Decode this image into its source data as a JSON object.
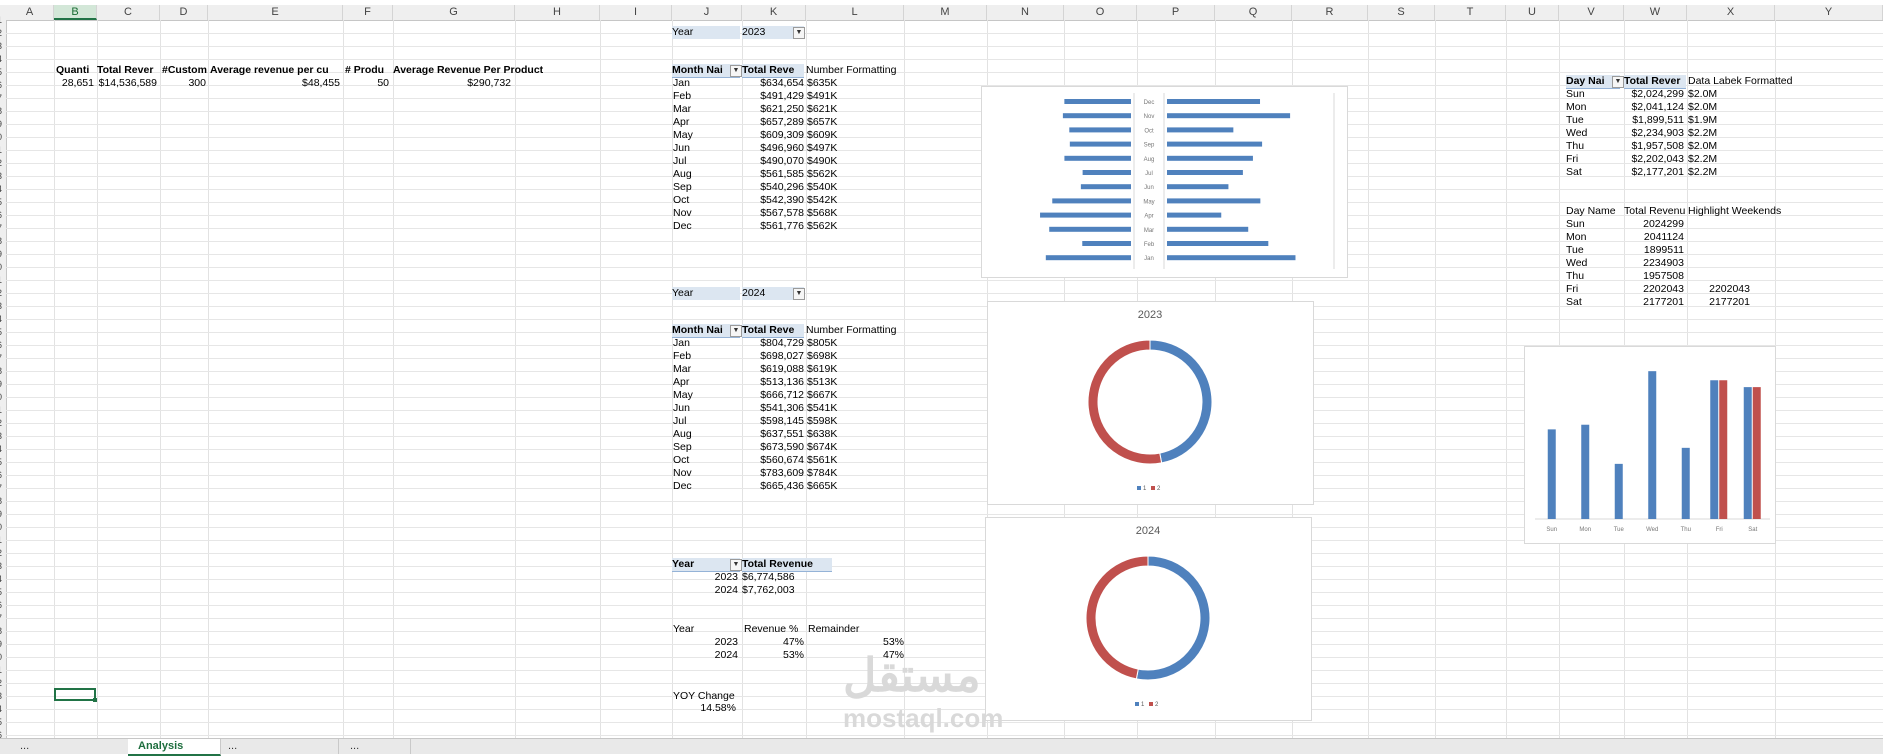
{
  "columns": [
    "A",
    "B",
    "C",
    "D",
    "E",
    "F",
    "G",
    "H",
    "I",
    "J",
    "K",
    "L",
    "M",
    "N",
    "O",
    "P",
    "Q",
    "R",
    "S",
    "T",
    "U",
    "V",
    "W",
    "X",
    "Y"
  ],
  "row_numbers": [
    "1",
    "2",
    "3",
    "4",
    "5",
    "6",
    "7",
    "8",
    "9",
    "0",
    "1",
    "2",
    "3",
    "4",
    "5",
    "6",
    "7",
    "8",
    "9",
    "0",
    "1",
    "2",
    "3",
    "4",
    "5",
    "6",
    "7",
    "8",
    "9",
    "0",
    "1",
    "2",
    "3",
    "4",
    "5",
    "6",
    "7",
    "8",
    "9",
    "0",
    "1",
    "2",
    "3",
    "4",
    "5",
    "6",
    "7",
    "8",
    "9",
    "0",
    "1",
    "2",
    "3",
    "4",
    "5",
    "6"
  ],
  "kpi": {
    "headers": [
      "Quanti",
      "Total Rever",
      "#Custom",
      "Average revenue per cu",
      "# Produ",
      "Average Revenue Per Product"
    ],
    "values": [
      "28,651",
      "$14,536,589",
      "300",
      "$48,455",
      "50",
      "$290,732"
    ]
  },
  "pivot2023": {
    "filter_label": "Year",
    "filter_value": "2023",
    "col1": "Month Nai",
    "col2": "Total Reve",
    "col3": "Number Formatting",
    "rows": [
      [
        "Jan",
        "$634,654",
        "$635K"
      ],
      [
        "Feb",
        "$491,429",
        "$491K"
      ],
      [
        "Mar",
        "$621,250",
        "$621K"
      ],
      [
        "Apr",
        "$657,289",
        "$657K"
      ],
      [
        "May",
        "$609,309",
        "$609K"
      ],
      [
        "Jun",
        "$496,960",
        "$497K"
      ],
      [
        "Jul",
        "$490,070",
        "$490K"
      ],
      [
        "Aug",
        "$561,585",
        "$562K"
      ],
      [
        "Sep",
        "$540,296",
        "$540K"
      ],
      [
        "Oct",
        "$542,390",
        "$542K"
      ],
      [
        "Nov",
        "$567,578",
        "$568K"
      ],
      [
        "Dec",
        "$561,776",
        "$562K"
      ]
    ]
  },
  "pivot2024": {
    "filter_label": "Year",
    "filter_value": "2024",
    "col1": "Month Nai",
    "col2": "Total Reve",
    "col3": "Number Formatting",
    "rows": [
      [
        "Jan",
        "$804,729",
        "$805K"
      ],
      [
        "Feb",
        "$698,027",
        "$698K"
      ],
      [
        "Mar",
        "$619,088",
        "$619K"
      ],
      [
        "Apr",
        "$513,136",
        "$513K"
      ],
      [
        "May",
        "$666,712",
        "$667K"
      ],
      [
        "Jun",
        "$541,306",
        "$541K"
      ],
      [
        "Jul",
        "$598,145",
        "$598K"
      ],
      [
        "Aug",
        "$637,551",
        "$638K"
      ],
      [
        "Sep",
        "$673,590",
        "$674K"
      ],
      [
        "Oct",
        "$560,674",
        "$561K"
      ],
      [
        "Nov",
        "$783,609",
        "$784K"
      ],
      [
        "Dec",
        "$665,436",
        "$665K"
      ]
    ]
  },
  "year_totals": {
    "col1": "Year",
    "col2": "Total Revenue",
    "rows": [
      [
        "2023",
        "$6,774,586"
      ],
      [
        "2024",
        "$7,762,003"
      ]
    ]
  },
  "revenue_pct": {
    "col1": "Year",
    "col2": "Revenue %",
    "col3": "Remainder",
    "rows": [
      [
        "2023",
        "47%",
        "53%"
      ],
      [
        "2024",
        "53%",
        "47%"
      ]
    ]
  },
  "yoy": {
    "label": "YOY Change",
    "value": "14.58%"
  },
  "day_pivot": {
    "col1": "Day Nai",
    "col2": "Total Rever",
    "col3": "Data Labek Formatted",
    "rows": [
      [
        "Sun",
        "$2,024,299",
        "$2.0M"
      ],
      [
        "Mon",
        "$2,041,124",
        "$2.0M"
      ],
      [
        "Tue",
        "$1,899,511",
        "$1.9M"
      ],
      [
        "Wed",
        "$2,234,903",
        "$2.2M"
      ],
      [
        "Thu",
        "$1,957,508",
        "$2.0M"
      ],
      [
        "Fri",
        "$2,202,043",
        "$2.2M"
      ],
      [
        "Sat",
        "$2,177,201",
        "$2.2M"
      ]
    ]
  },
  "day_table": {
    "col1": "Day Name",
    "col2": "Total Revenu",
    "col3": "Highlight Weekends",
    "rows": [
      [
        "Sun",
        "2024299",
        ""
      ],
      [
        "Mon",
        "2041124",
        ""
      ],
      [
        "Tue",
        "1899511",
        ""
      ],
      [
        "Wed",
        "2234903",
        ""
      ],
      [
        "Thu",
        "1957508",
        ""
      ],
      [
        "Fri",
        "2202043",
        "2202043"
      ],
      [
        "Sat",
        "2177201",
        "2177201"
      ]
    ]
  },
  "chart_data": [
    {
      "type": "bar",
      "orientation": "horizontal-butterfly",
      "title": "",
      "categories": [
        "Dec",
        "Nov",
        "Oct",
        "Sep",
        "Aug",
        "Jul",
        "Jun",
        "May",
        "Apr",
        "Mar",
        "Feb",
        "Jan"
      ],
      "series": [
        {
          "values": [
            561776,
            567578,
            542390,
            540296,
            561585,
            490070,
            496960,
            609309,
            657289,
            621250,
            491429,
            634654
          ]
        },
        {
          "values": [
            665436,
            783609,
            560674,
            673590,
            637551,
            598145,
            541306,
            666712,
            513136,
            619088,
            698027,
            804729
          ]
        }
      ],
      "colors": [
        "#4f81bd",
        "#4f81bd"
      ],
      "xlim": [
        0,
        850000
      ]
    },
    {
      "type": "pie",
      "variant": "doughnut",
      "title": "2023",
      "categories": [
        "1",
        "2"
      ],
      "values": [
        47,
        53
      ],
      "colors": [
        "#4f81bd",
        "#c0504d"
      ],
      "legend": "bottom"
    },
    {
      "type": "pie",
      "variant": "doughnut",
      "title": "2024",
      "categories": [
        "1",
        "2"
      ],
      "values": [
        53,
        47
      ],
      "colors": [
        "#4f81bd",
        "#c0504d"
      ],
      "legend": "bottom"
    },
    {
      "type": "bar",
      "title": "",
      "categories": [
        "Sun",
        "Mon",
        "Tue",
        "Wed",
        "Thu",
        "Fri",
        "Sat"
      ],
      "series": [
        {
          "values": [
            2024299,
            2041124,
            1899511,
            2234903,
            1957508,
            2202043,
            2177201
          ]
        },
        {
          "values": [
            null,
            null,
            null,
            null,
            null,
            2202043,
            2177201
          ]
        }
      ],
      "colors": [
        "#4f81bd",
        "#c0504d"
      ],
      "ylim": [
        1700000,
        2250000
      ]
    }
  ],
  "sheet_tabs": [
    "...",
    "Analysis",
    "...",
    "..."
  ],
  "watermark": {
    "arabic": "مستقل",
    "latin": "mostaql.com"
  }
}
